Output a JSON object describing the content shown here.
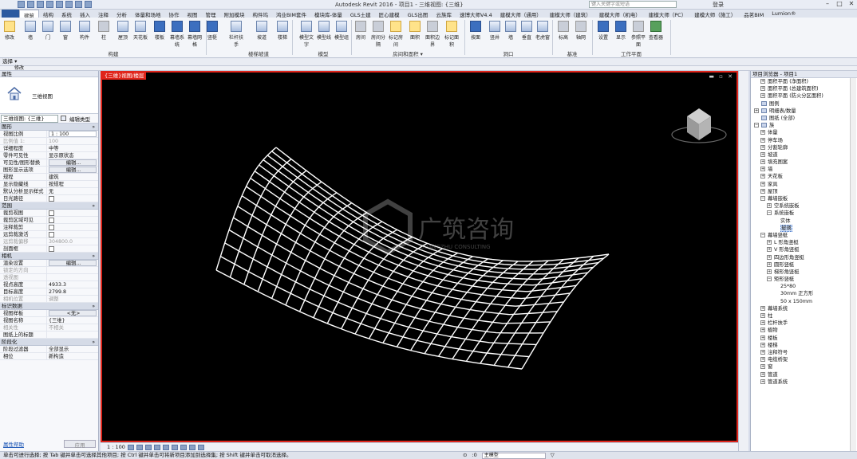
{
  "app": {
    "title": "Autodesk Revit 2016 -    项目1 - 三维视图: {三维}",
    "search_placeholder": "键入关键字或短语",
    "user": "登录",
    "help": "?"
  },
  "tabs": [
    "建筑",
    "结构",
    "系统",
    "插入",
    "注释",
    "分析",
    "体量和场地",
    "协作",
    "视图",
    "管理",
    "附加模块",
    "构件坞",
    "鸿业BIM套件",
    "模块库-体量",
    "GLS土建",
    "匠心建模",
    "GLS出图",
    "云族库",
    "速博大师V4.4",
    "建模大师（通用）",
    "建模大师（建筑）",
    "建模大师（机电）",
    "建模大师（PC）",
    "建模大师（施工）",
    "品茗BIM",
    "Lumion®"
  ],
  "ribbon": {
    "buttons": [
      {
        "label": "修改",
        "icon": "modify-arrow-icon"
      },
      {
        "label": "墙",
        "icon": "wall-icon"
      },
      {
        "label": "门",
        "icon": "door-icon"
      },
      {
        "label": "窗",
        "icon": "window-icon"
      },
      {
        "label": "构件",
        "icon": "component-icon"
      },
      {
        "label": "柱",
        "icon": "column-icon"
      },
      {
        "label": "屋顶",
        "icon": "roof-icon"
      },
      {
        "label": "天花板",
        "icon": "ceiling-icon"
      },
      {
        "label": "楼板",
        "icon": "floor-icon"
      },
      {
        "label": "幕墙系统",
        "icon": "curtain-system-icon"
      },
      {
        "label": "幕墙网格",
        "icon": "curtain-grid-icon"
      },
      {
        "label": "竖梃",
        "icon": "mullion-icon"
      },
      {
        "label": "栏杆扶手",
        "icon": "railing-icon"
      },
      {
        "label": "坡道",
        "icon": "ramp-icon"
      },
      {
        "label": "楼梯",
        "icon": "stair-icon"
      },
      {
        "label": "模型文字",
        "icon": "model-text-icon"
      },
      {
        "label": "模型线",
        "icon": "model-line-icon"
      },
      {
        "label": "模型组",
        "icon": "model-group-icon"
      },
      {
        "label": "房间",
        "icon": "room-icon"
      },
      {
        "label": "房间分隔",
        "icon": "room-separator-icon"
      },
      {
        "label": "标记房间",
        "icon": "tag-room-icon"
      },
      {
        "label": "面积",
        "icon": "area-icon"
      },
      {
        "label": "面积边界",
        "icon": "area-boundary-icon"
      },
      {
        "label": "标记面积",
        "icon": "tag-area-icon"
      },
      {
        "label": "按面",
        "icon": "by-face-icon"
      },
      {
        "label": "竖井",
        "icon": "shaft-icon"
      },
      {
        "label": "墙",
        "icon": "wall-opening-icon"
      },
      {
        "label": "垂直",
        "icon": "vertical-icon"
      },
      {
        "label": "老虎窗",
        "icon": "dormer-icon"
      },
      {
        "label": "标高",
        "icon": "level-icon"
      },
      {
        "label": "轴网",
        "icon": "grid-icon"
      },
      {
        "label": "设置",
        "icon": "set-icon"
      },
      {
        "label": "显示",
        "icon": "show-icon"
      },
      {
        "label": "参照平面",
        "icon": "ref-plane-icon"
      },
      {
        "label": "查看器",
        "icon": "viewer-icon"
      }
    ],
    "groups": [
      "构建",
      "楼梯坡道",
      "模型",
      "房间和面积 ▾",
      "洞口",
      "基准",
      "工作平面"
    ]
  },
  "optionsbar": {
    "label": "选择 ▾"
  },
  "viewbar": {
    "label": "修改"
  },
  "properties": {
    "header": "属性",
    "type_name": "三维视图",
    "dropdown": "三维视图: {三维}",
    "edit_type": "编辑类型",
    "sections": [
      {
        "title": "图形",
        "rows": [
          {
            "k": "视图比例",
            "v": "1 : 100",
            "t": "box"
          },
          {
            "k": "比例值 1:",
            "v": "100",
            "t": "grey"
          },
          {
            "k": "详细程度",
            "v": "中等",
            "t": "plain"
          },
          {
            "k": "零件可见性",
            "v": "显示原状态",
            "t": "plain"
          },
          {
            "k": "可见性/图形替换",
            "v": "编辑...",
            "t": "btn"
          },
          {
            "k": "图形显示选项",
            "v": "编辑...",
            "t": "btn"
          },
          {
            "k": "规程",
            "v": "建筑",
            "t": "plain"
          },
          {
            "k": "显示隐藏线",
            "v": "按规程",
            "t": "plain"
          },
          {
            "k": "默认分析显示样式",
            "v": "无",
            "t": "plain"
          },
          {
            "k": "日光路径",
            "v": "",
            "t": "check"
          }
        ]
      },
      {
        "title": "范围",
        "rows": [
          {
            "k": "裁剪视图",
            "v": "",
            "t": "check"
          },
          {
            "k": "裁剪区域可见",
            "v": "",
            "t": "check"
          },
          {
            "k": "注释裁剪",
            "v": "",
            "t": "check"
          },
          {
            "k": "远剪裁激活",
            "v": "",
            "t": "check"
          },
          {
            "k": "远剪裁偏移",
            "v": "304800.0",
            "t": "grey"
          },
          {
            "k": "剖面框",
            "v": "",
            "t": "check"
          }
        ]
      },
      {
        "title": "相机",
        "rows": [
          {
            "k": "渲染设置",
            "v": "编辑...",
            "t": "btn"
          },
          {
            "k": "锁定的方向",
            "v": "",
            "t": "grey"
          },
          {
            "k": "透视图",
            "v": "",
            "t": "grey"
          },
          {
            "k": "视点高度",
            "v": "4933.3",
            "t": "plain"
          },
          {
            "k": "目标高度",
            "v": "2799.8",
            "t": "plain"
          },
          {
            "k": "相机位置",
            "v": "调整",
            "t": "grey"
          }
        ]
      },
      {
        "title": "标识数据",
        "rows": [
          {
            "k": "视图样板",
            "v": "<无>",
            "t": "btn"
          },
          {
            "k": "视图名称",
            "v": "{三维}",
            "t": "plain"
          },
          {
            "k": "相关性",
            "v": "不相关",
            "t": "grey"
          },
          {
            "k": "图纸上的标题",
            "v": "",
            "t": "plain"
          }
        ]
      },
      {
        "title": "阶段化",
        "rows": [
          {
            "k": "阶段过滤器",
            "v": "全部显示",
            "t": "plain"
          },
          {
            "k": "相位",
            "v": "新构造",
            "t": "plain"
          }
        ]
      }
    ],
    "help_link": "属性帮助",
    "apply": "应用"
  },
  "viewport": {
    "title": "{三维}视图/楼层",
    "scale": "1 : 100",
    "watermark": "广筑咨询",
    "watermark_sub": "GUANGZHU CONSULTING"
  },
  "browser": {
    "header": "项目浏览器 - 项目1",
    "items": [
      {
        "lv": 1,
        "g": "+",
        "l": "面积平面 (净面积)"
      },
      {
        "lv": 1,
        "g": "+",
        "l": "面积平面 (总建筑面积)"
      },
      {
        "lv": 1,
        "g": "+",
        "l": "面积平面 (防火分区面积)"
      },
      {
        "lv": 0,
        "g": "",
        "f": 1,
        "l": "图例"
      },
      {
        "lv": 0,
        "g": "+",
        "f": 1,
        "l": "明细表/数量"
      },
      {
        "lv": 0,
        "g": "",
        "f": 1,
        "l": "图纸 (全部)"
      },
      {
        "lv": 0,
        "g": "−",
        "f": 1,
        "l": "族"
      },
      {
        "lv": 1,
        "g": "+",
        "l": "体量"
      },
      {
        "lv": 1,
        "g": "+",
        "l": "停车场"
      },
      {
        "lv": 1,
        "g": "+",
        "l": "分割轮廓"
      },
      {
        "lv": 1,
        "g": "+",
        "l": "坡道"
      },
      {
        "lv": 1,
        "g": "+",
        "l": "填充图案"
      },
      {
        "lv": 1,
        "g": "+",
        "l": "墙"
      },
      {
        "lv": 1,
        "g": "+",
        "l": "天花板"
      },
      {
        "lv": 1,
        "g": "+",
        "l": "家具"
      },
      {
        "lv": 1,
        "g": "+",
        "l": "屋顶"
      },
      {
        "lv": 1,
        "g": "−",
        "l": "幕墙嵌板"
      },
      {
        "lv": 2,
        "g": "+",
        "l": "空系统嵌板"
      },
      {
        "lv": 2,
        "g": "−",
        "l": "系统嵌板"
      },
      {
        "lv": 3,
        "g": "",
        "l": "实体"
      },
      {
        "lv": 3,
        "g": "",
        "l": "玻璃",
        "sel": 1
      },
      {
        "lv": 1,
        "g": "−",
        "l": "幕墙竖梃"
      },
      {
        "lv": 2,
        "g": "+",
        "l": "L 形角竖梃"
      },
      {
        "lv": 2,
        "g": "+",
        "l": "V 形角竖梃"
      },
      {
        "lv": 2,
        "g": "+",
        "l": "四边形角竖梃"
      },
      {
        "lv": 2,
        "g": "+",
        "l": "圆形竖梃"
      },
      {
        "lv": 2,
        "g": "+",
        "l": "梯形角竖梃"
      },
      {
        "lv": 2,
        "g": "−",
        "l": "矩形竖梃"
      },
      {
        "lv": 3,
        "g": "",
        "l": "25*80"
      },
      {
        "lv": 3,
        "g": "",
        "l": "30mm 正方形"
      },
      {
        "lv": 3,
        "g": "",
        "l": "50 x 150mm"
      },
      {
        "lv": 1,
        "g": "+",
        "l": "幕墙系统"
      },
      {
        "lv": 1,
        "g": "+",
        "l": "柱"
      },
      {
        "lv": 1,
        "g": "+",
        "l": "栏杆扶手"
      },
      {
        "lv": 1,
        "g": "+",
        "l": "植物"
      },
      {
        "lv": 1,
        "g": "+",
        "l": "楼板"
      },
      {
        "lv": 1,
        "g": "+",
        "l": "楼梯"
      },
      {
        "lv": 1,
        "g": "+",
        "l": "注释符号"
      },
      {
        "lv": 1,
        "g": "+",
        "l": "电缆桥架"
      },
      {
        "lv": 1,
        "g": "+",
        "l": "窗"
      },
      {
        "lv": 1,
        "g": "+",
        "l": "管道"
      },
      {
        "lv": 1,
        "g": "+",
        "l": "管道系统"
      }
    ]
  },
  "status": {
    "text": "单击可进行选择; 按 Tab 键并单击可选择其他项目; 按 Ctrl 键并单击可将新项目添加到选择集; 按 Shift 键并单击可取消选择。",
    "model": "主模型",
    "zero": ":0"
  }
}
